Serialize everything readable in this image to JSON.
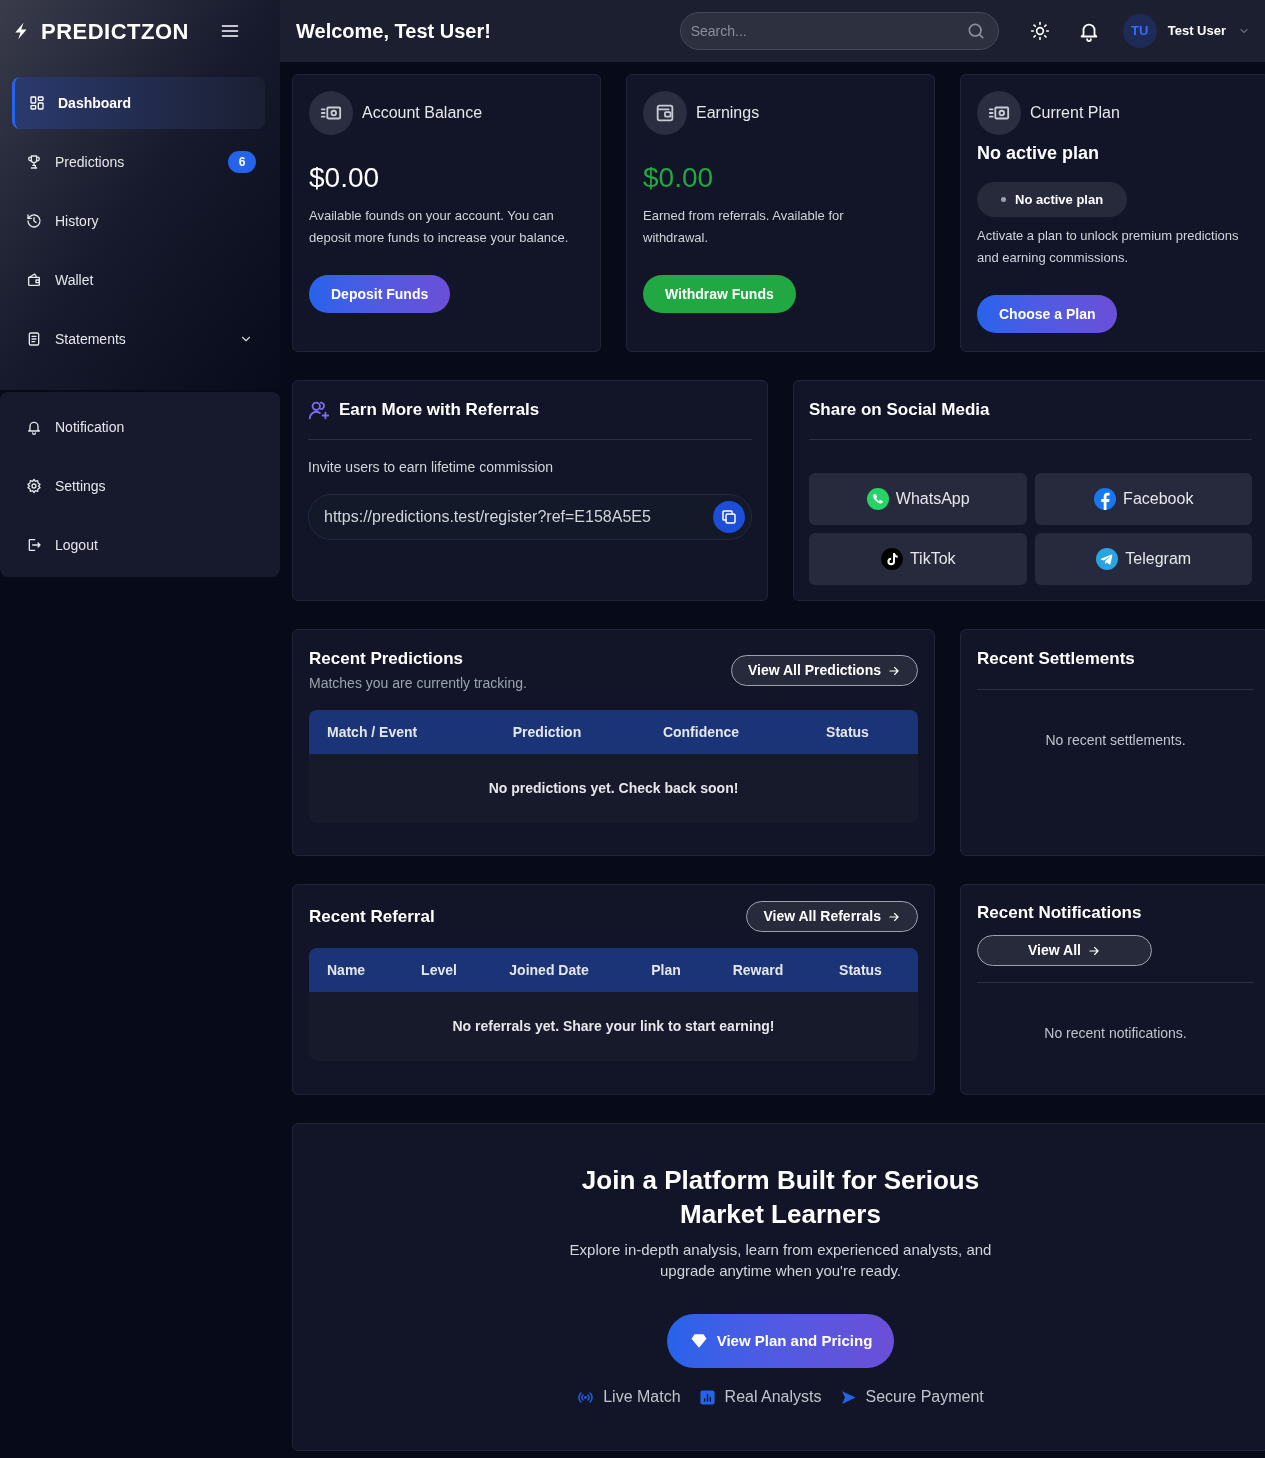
{
  "sidebar": {
    "logo": "PREDICTZON",
    "nav": [
      {
        "label": "Dashboard",
        "kind": "link",
        "selected": true
      },
      {
        "label": "Predictions",
        "kind": "link",
        "selected": false,
        "badge": "6"
      },
      {
        "label": "History",
        "kind": "link",
        "selected": false
      },
      {
        "label": "Wallet",
        "kind": "link",
        "selected": false
      },
      {
        "label": "Statements",
        "kind": "dropdown",
        "selected": false
      }
    ],
    "account_nav": [
      {
        "label": "Notification",
        "selected": false
      },
      {
        "label": "Settings",
        "selected": false
      },
      {
        "label": "Logout",
        "selected": false
      }
    ]
  },
  "header": {
    "title": "Welcome, Test User!",
    "search": {
      "placeholder": "Search..."
    },
    "user": {
      "initials": "TU",
      "name": "Test User"
    }
  },
  "summary_cards": [
    {
      "kind": "balance",
      "title": "Account Balance",
      "amount": "$0.00",
      "description": "Available founds on your account. You can deposit more funds to increase your balance.",
      "button": "Deposit Funds"
    },
    {
      "kind": "earnings",
      "title": "Earnings",
      "amount": "$0.00",
      "description": "Earned from referrals. Available for withdrawal.",
      "button": "Withdraw Funds"
    },
    {
      "kind": "plan",
      "title": "Current Plan",
      "subtitle": "No active plan",
      "status": "No active plan",
      "description": "Activate a plan to unlock premium predictions and earning commissions.",
      "button": "Choose a Plan"
    }
  ],
  "referral": {
    "title": "Earn More with Referrals",
    "subtitle": "Invite users to earn lifetime commission",
    "link": "https://predictions.test/register?ref=E158A5E5"
  },
  "social_share": {
    "title": "Share on Social Media",
    "buttons": [
      {
        "label": "WhatsApp"
      },
      {
        "label": "Facebook"
      },
      {
        "label": "TikTok"
      },
      {
        "label": "Telegram"
      }
    ]
  },
  "recent_predictions": {
    "title": "Recent Predictions",
    "subtitle": "Matches you are currently tracking.",
    "button": "View All Predictions",
    "columns": [
      "Match / Event",
      "Prediction",
      "Confidence",
      "Status"
    ],
    "empty_message": "No predictions yet. Check back soon!"
  },
  "recent_settlements": {
    "title": "Recent Settlements",
    "empty_message": "No recent settlements."
  },
  "recent_referral": {
    "title": "Recent Referral",
    "button": "View All Referrals",
    "columns": [
      "Name",
      "Level",
      "Joined Date",
      "Plan",
      "Reward",
      "Status"
    ],
    "empty_message": "No referrals yet. Share your link to start earning!"
  },
  "recent_notifications": {
    "title": "Recent Notifications",
    "button": "View All",
    "empty_message": "No recent notifications."
  },
  "promo": {
    "title": "Join a Platform Built for Serious Market Learners",
    "text": "Explore in-depth analysis, learn from experienced analysts, and upgrade anytime when you're ready.",
    "button": "View Plan and Pricing",
    "features": [
      {
        "label": "Live Match"
      },
      {
        "label": "Real Analysts"
      },
      {
        "label": "Secure Payment"
      }
    ]
  }
}
